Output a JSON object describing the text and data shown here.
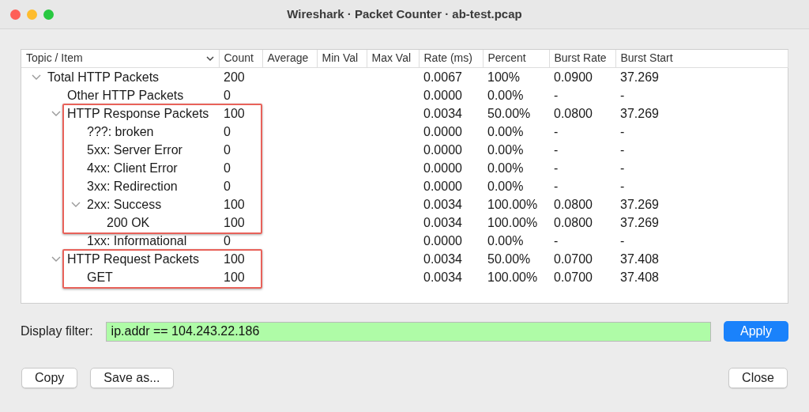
{
  "window": {
    "title": "Wireshark · Packet Counter · ab-test.pcap"
  },
  "table": {
    "columns": [
      {
        "label": "Topic / Item",
        "sorted": true
      },
      {
        "label": "Count"
      },
      {
        "label": "Average"
      },
      {
        "label": "Min Val"
      },
      {
        "label": "Max Val"
      },
      {
        "label": "Rate (ms)"
      },
      {
        "label": "Percent"
      },
      {
        "label": "Burst Rate"
      },
      {
        "label": "Burst Start"
      }
    ],
    "rows": [
      {
        "item": "Total HTTP Packets",
        "count": "200",
        "rate": "0.0067",
        "percent": "100%",
        "burst_rate": "0.0900",
        "burst_start": "37.269",
        "boxed": false,
        "expanded": true,
        "children": [
          {
            "item": "Other HTTP Packets",
            "count": "0",
            "rate": "0.0000",
            "percent": "0.00%",
            "burst_rate": "-",
            "burst_start": "-",
            "boxed": false
          },
          {
            "item": "HTTP Response Packets",
            "count": "100",
            "rate": "0.0034",
            "percent": "50.00%",
            "burst_rate": "0.0800",
            "burst_start": "37.269",
            "boxed": true,
            "expanded": true,
            "children": [
              {
                "item": "???: broken",
                "count": "0",
                "rate": "0.0000",
                "percent": "0.00%",
                "burst_rate": "-",
                "burst_start": "-",
                "boxed": true
              },
              {
                "item": "5xx: Server Error",
                "count": "0",
                "rate": "0.0000",
                "percent": "0.00%",
                "burst_rate": "-",
                "burst_start": "-",
                "boxed": true
              },
              {
                "item": "4xx: Client Error",
                "count": "0",
                "rate": "0.0000",
                "percent": "0.00%",
                "burst_rate": "-",
                "burst_start": "-",
                "boxed": true
              },
              {
                "item": "3xx: Redirection",
                "count": "0",
                "rate": "0.0000",
                "percent": "0.00%",
                "burst_rate": "-",
                "burst_start": "-",
                "boxed": true
              },
              {
                "item": "2xx: Success",
                "count": "100",
                "rate": "0.0034",
                "percent": "100.00%",
                "burst_rate": "0.0800",
                "burst_start": "37.269",
                "boxed": true,
                "expanded": true,
                "children": [
                  {
                    "item": "200 OK",
                    "count": "100",
                    "rate": "0.0034",
                    "percent": "100.00%",
                    "burst_rate": "0.0800",
                    "burst_start": "37.269",
                    "boxed": true
                  }
                ]
              },
              {
                "item": "1xx: Informational",
                "count": "0",
                "rate": "0.0000",
                "percent": "0.00%",
                "burst_rate": "-",
                "burst_start": "-",
                "boxed": false
              }
            ]
          },
          {
            "item": "HTTP Request Packets",
            "count": "100",
            "rate": "0.0034",
            "percent": "50.00%",
            "burst_rate": "0.0700",
            "burst_start": "37.408",
            "boxed": true,
            "expanded": true,
            "children": [
              {
                "item": "GET",
                "count": "100",
                "rate": "0.0034",
                "percent": "100.00%",
                "burst_rate": "0.0700",
                "burst_start": "37.408",
                "boxed": true
              }
            ]
          }
        ]
      }
    ]
  },
  "display_filter": {
    "label": "Display filter:",
    "value": "ip.addr == 104.243.22.186",
    "valid": true
  },
  "apply_button": "Apply",
  "buttons": [
    {
      "label": "Copy"
    },
    {
      "label": "Save as..."
    },
    {
      "label": "Close"
    }
  ]
}
